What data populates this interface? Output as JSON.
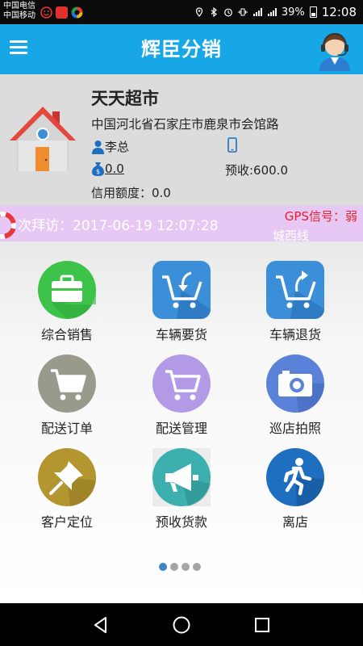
{
  "status_bar": {
    "carrier_1": "中国电信",
    "carrier_2": "中国移动",
    "battery": "39%",
    "time": "12:08"
  },
  "app_bar": {
    "title": "辉臣分销",
    "menu_icon": "hamburger-menu-icon",
    "support_icon": "customer-service-avatar-icon"
  },
  "store": {
    "name": "天天超市",
    "address": "中国河北省石家庄市鹿泉市会馆路",
    "contact": "李总",
    "balance": "0.0",
    "prepaid": "预收:600.0",
    "credit": "信用额度：0.0"
  },
  "visit": {
    "last_visit": "次拜访：2017-06-19 12:07:28",
    "gps": "GPS信号：弱",
    "route": "城西线"
  },
  "menu": [
    {
      "label": "综合销售",
      "icon": "briefcase-icon",
      "color": "#3dc24a"
    },
    {
      "label": "车辆要货",
      "icon": "cart-return-in-icon",
      "color": "#3a8fd8"
    },
    {
      "label": "车辆退货",
      "icon": "cart-return-out-icon",
      "color": "#3a8fd8"
    },
    {
      "label": "配送订单",
      "icon": "cart-icon",
      "color": "#9a9a8c"
    },
    {
      "label": "配送管理",
      "icon": "cart-outline-icon",
      "color": "#b39ae6"
    },
    {
      "label": "巡店拍照",
      "icon": "camera-icon",
      "color": "#5a82d8"
    },
    {
      "label": "客户定位",
      "icon": "pushpin-icon",
      "color": "#b39630"
    },
    {
      "label": "预收货款",
      "icon": "megaphone-icon",
      "color": "#3bb0ae"
    },
    {
      "label": "离店",
      "icon": "running-exit-icon",
      "color": "#1f6fc0"
    }
  ],
  "pager": {
    "pages": 4,
    "current": 1
  },
  "nav_bar": {
    "icons": [
      "back-triangle-icon",
      "home-circle-icon",
      "recents-square-icon"
    ]
  }
}
